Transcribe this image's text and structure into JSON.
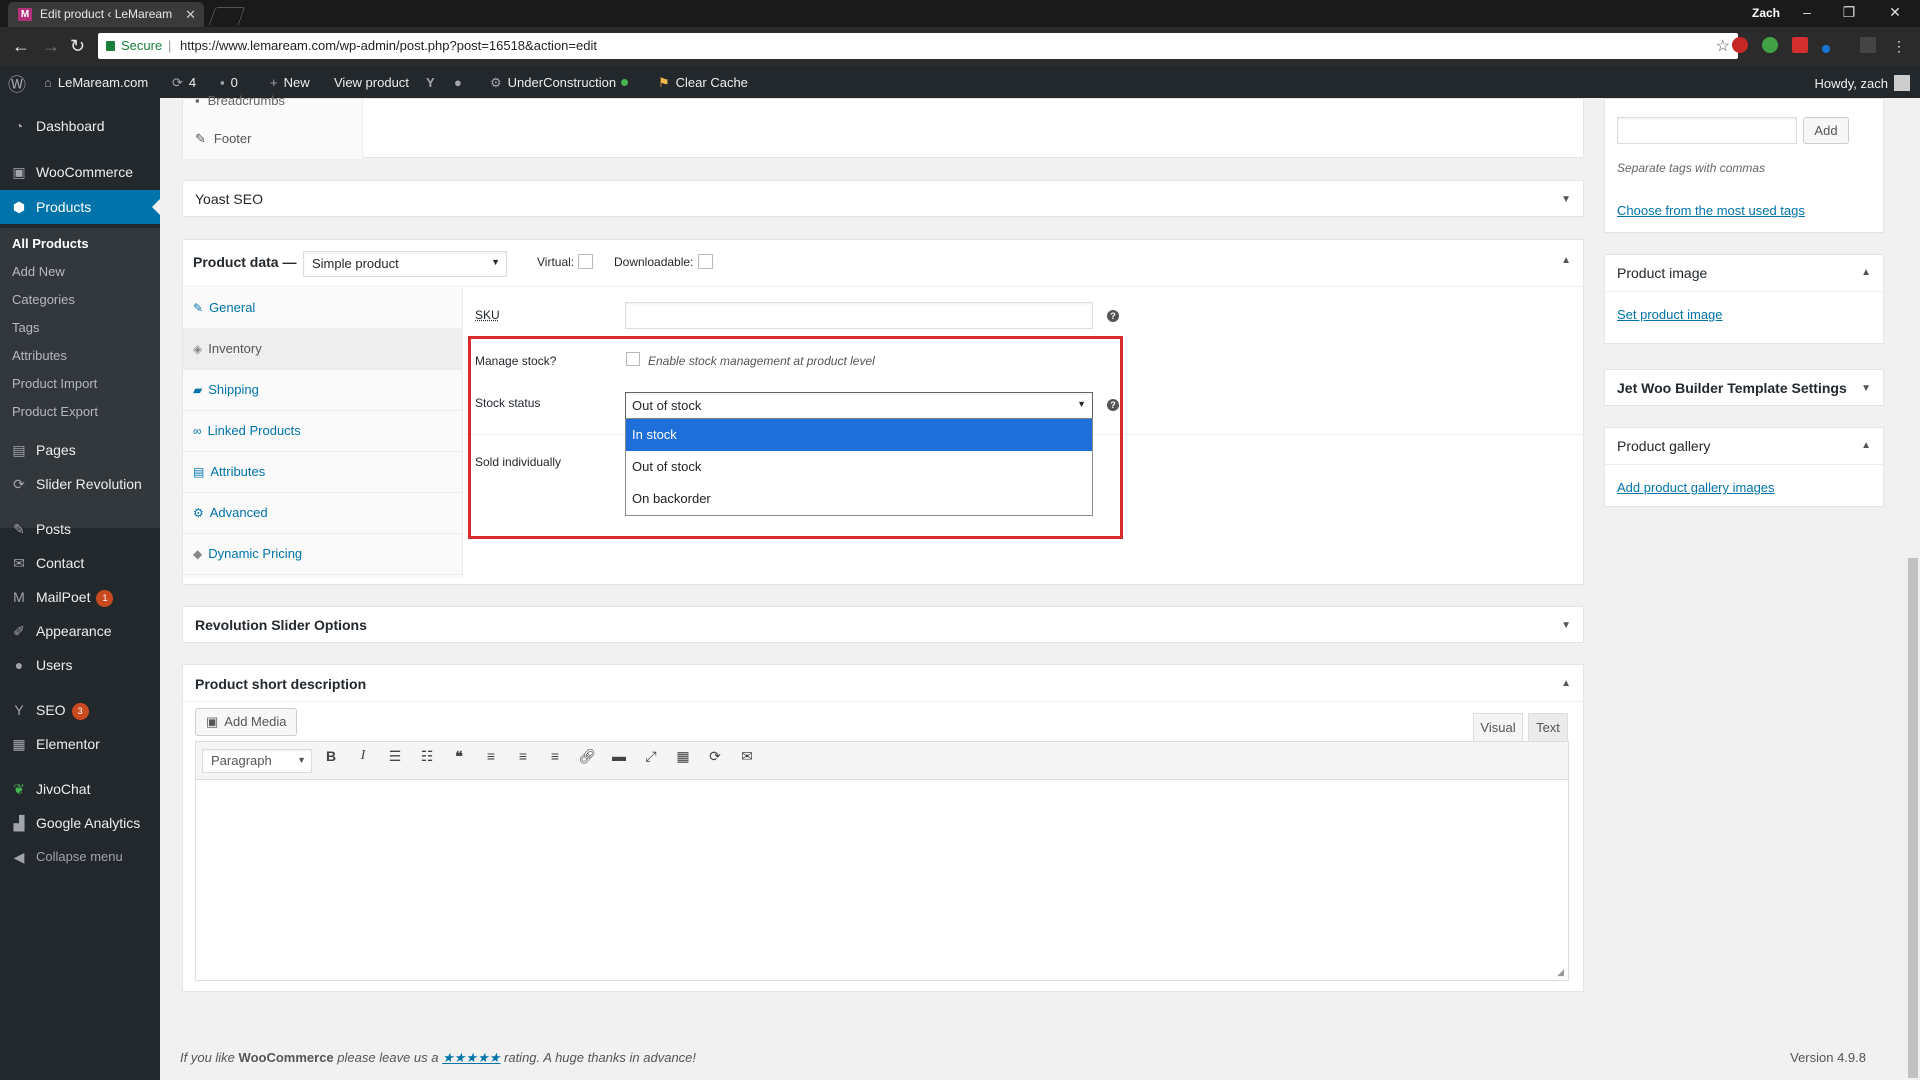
{
  "browser": {
    "tab_title": "Edit product ‹ LeMaream",
    "tab_favicon": "M",
    "profile_name": "Zach",
    "secure_label": "Secure",
    "url": "https://www.lemaream.com/wp-admin/post.php?post=16518&action=edit"
  },
  "adminbar": {
    "site_name": "LeMaream.com",
    "updates_count": "4",
    "comments_count": "0",
    "new_label": "New",
    "view_product": "View product",
    "under_construction": "UnderConstruction",
    "clear_cache": "Clear Cache",
    "howdy": "Howdy, zach"
  },
  "sidebar": {
    "dashboard": "Dashboard",
    "woocommerce": "WooCommerce",
    "products": "Products",
    "sub": [
      "All Products",
      "Add New",
      "Categories",
      "Tags",
      "Attributes",
      "Product Import",
      "Product Export"
    ],
    "pages": "Pages",
    "slider_revolution": "Slider Revolution",
    "posts": "Posts",
    "contact": "Contact",
    "mailpoet": "MailPoet",
    "mailpoet_badge": "1",
    "appearance": "Appearance",
    "users": "Users",
    "seo": "SEO",
    "seo_badge": "3",
    "elementor": "Elementor",
    "jivochat": "JivoChat",
    "google_analytics": "Google Analytics",
    "collapse": "Collapse menu"
  },
  "top_panel": {
    "breadcrumbs": "Breadcrumbs",
    "footer": "Footer"
  },
  "yoast": {
    "title": "Yoast SEO"
  },
  "product_data": {
    "title": "Product data —",
    "type_value": "Simple product",
    "virtual_label": "Virtual:",
    "downloadable_label": "Downloadable:",
    "tabs": [
      "General",
      "Inventory",
      "Shipping",
      "Linked Products",
      "Attributes",
      "Advanced",
      "Dynamic Pricing"
    ],
    "sku_label": "SKU",
    "manage_stock_label": "Manage stock?",
    "manage_stock_desc": "Enable stock management at product level",
    "stock_status_label": "Stock status",
    "stock_status_value": "Out of stock",
    "stock_options": [
      "In stock",
      "Out of stock",
      "On backorder"
    ],
    "sold_individually_label": "Sold individually"
  },
  "revslider": {
    "title": "Revolution Slider Options"
  },
  "short_desc": {
    "title": "Product short description",
    "add_media": "Add Media",
    "visual_tab": "Visual",
    "text_tab": "Text",
    "format_value": "Paragraph"
  },
  "right_col": {
    "add_button": "Add",
    "tags_hint": "Separate tags with commas",
    "most_used": "Choose from the most used tags",
    "product_image_title": "Product image",
    "set_image": "Set product image",
    "jet_woo_title": "Jet Woo Builder Template Settings",
    "gallery_title": "Product gallery",
    "add_gallery": "Add product gallery images"
  },
  "footer": {
    "text_before": "If you like",
    "brand": "WooCommerce",
    "text_mid": "please leave us a",
    "stars": "★★★★★",
    "text_after": "rating. A huge thanks in advance!",
    "version": "Version 4.9.8"
  },
  "colors": {
    "accent": "#0073aa",
    "admin_dark": "#23282d",
    "highlight_red": "#d62b2b",
    "dropdown_selected": "#1e6fd9"
  }
}
